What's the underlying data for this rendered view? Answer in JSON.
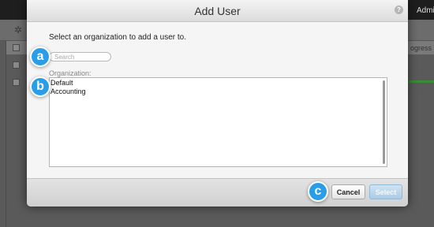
{
  "background": {
    "top_bar_user": "Admi",
    "column_header": "ogress",
    "toolbar_icon": "gear-icon"
  },
  "dialog": {
    "title": "Add User",
    "help_icon": "help-icon",
    "help_glyph": "?",
    "instruction": "Select an organization to add a user to.",
    "search": {
      "placeholder": "Search",
      "value": ""
    },
    "organization_label": "Organization:",
    "organizations": [
      "Default",
      "Accounting"
    ],
    "buttons": {
      "cancel": "Cancel",
      "select": "Select"
    }
  },
  "markers": [
    "a",
    "b",
    "c"
  ],
  "colors": {
    "accent": "#2a9de8",
    "select_button": "#aacbe6",
    "overlay": "#5a5a5a"
  }
}
